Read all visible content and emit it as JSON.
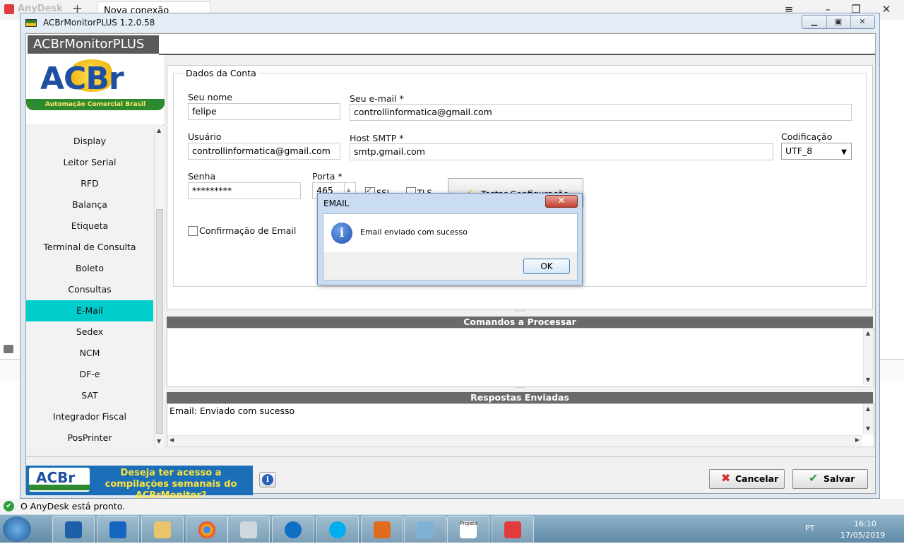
{
  "anydesk": {
    "app_name": "AnyDesk",
    "new_tab_plus": "+",
    "tab_label": "Nova conexão",
    "status_text": "O AnyDesk está pronto."
  },
  "window": {
    "title": "ACBrMonitorPLUS 1.2.0.58",
    "header": "ACBrMonitorPLUS"
  },
  "logo": {
    "brand": "ACBr",
    "tagline": "Automação Comercial Brasil"
  },
  "sidebar": {
    "items": [
      {
        "label": "Display"
      },
      {
        "label": "Leitor Serial"
      },
      {
        "label": "RFD"
      },
      {
        "label": "Balança"
      },
      {
        "label": "Etiqueta"
      },
      {
        "label": "Terminal de Consulta"
      },
      {
        "label": "Boleto"
      },
      {
        "label": "Consultas"
      },
      {
        "label": "E-Mail"
      },
      {
        "label": "Sedex"
      },
      {
        "label": "NCM"
      },
      {
        "label": "DF-e"
      },
      {
        "label": "SAT"
      },
      {
        "label": "Integrador Fiscal"
      },
      {
        "label": "PosPrinter"
      }
    ],
    "active_index": 8
  },
  "form": {
    "legend": "Dados da Conta",
    "nome_label": "Seu nome",
    "nome_value": "felipe",
    "email_label": "Seu e-mail *",
    "email_value": "controllinformatica@gmail.com",
    "usuario_label": "Usuário",
    "usuario_value": "controllinformatica@gmail.com",
    "host_label": "Host SMTP *",
    "host_value": "smtp.gmail.com",
    "codif_label": "Codificação",
    "codif_value": "UTF_8",
    "senha_label": "Senha",
    "senha_value": "*********",
    "porta_label": "Porta *",
    "porta_value": "465",
    "ssl_label": "SSL",
    "ssl_checked": true,
    "tls_label": "TLS",
    "tls_checked": false,
    "confirm_label": "Confirmação de Email",
    "confirm_checked": false,
    "test_button": "Testar Configuração"
  },
  "panels": {
    "comandos_title": "Comandos a Processar",
    "comandos_text": "",
    "respostas_title": "Respostas Enviadas",
    "respostas_text": "Email: Enviado com sucesso"
  },
  "footer": {
    "banner_text": "Deseja ter acesso a compilações semanais do ACBrMonitor?",
    "cancel_label": "Cancelar",
    "save_label": "Salvar"
  },
  "dialog": {
    "title": "EMAIL",
    "message": "Email enviado com sucesso",
    "ok_label": "OK"
  },
  "taskbar": {
    "apps": [
      "virtualbox",
      "outlook",
      "explorer",
      "chrome",
      "calculator",
      "teamviewer",
      "skype",
      "firefox-fox",
      "control-panel",
      "projeto-acbr",
      "anydesk"
    ],
    "projeto_label": "Projeto",
    "lang": "PT",
    "time": "16:10",
    "date": "17/05/2019"
  },
  "colors": {
    "active_nav": "#00cccc",
    "header_bar": "#5a5a5a",
    "anydesk_red": "#e23b3b",
    "banner_blue": "#1b6fb8",
    "banner_yellow": "#ffe33a"
  }
}
